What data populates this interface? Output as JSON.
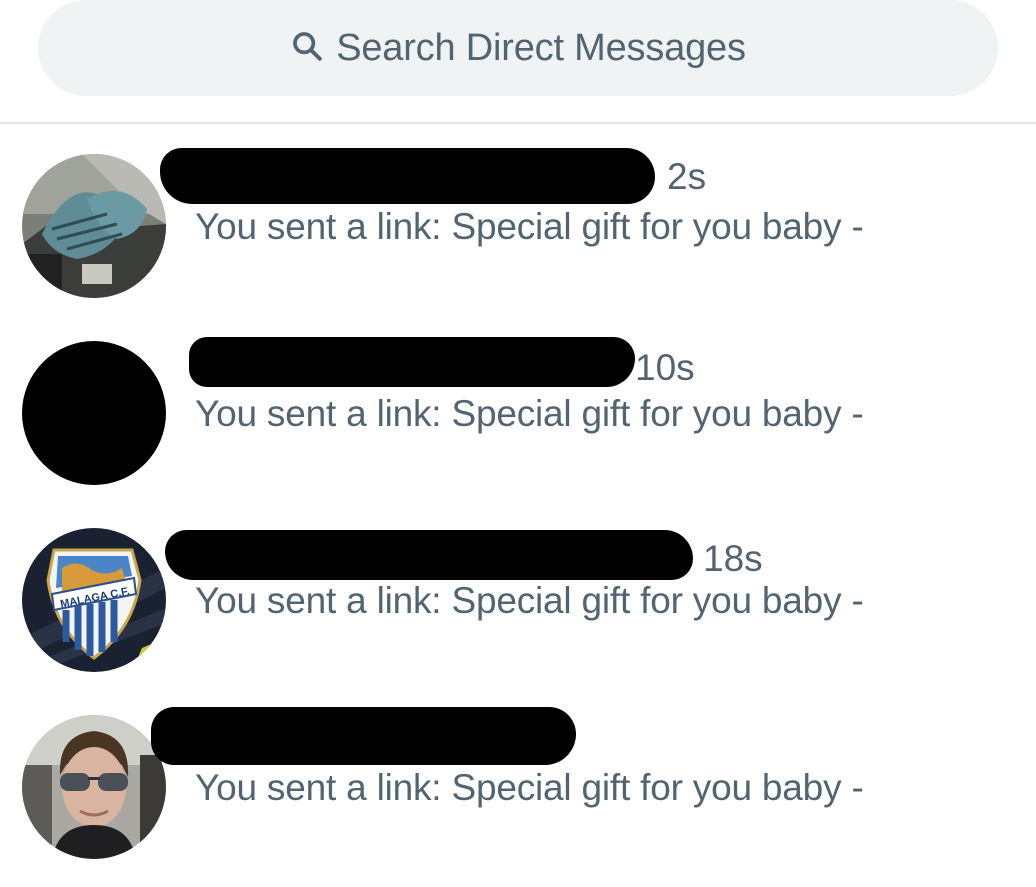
{
  "search": {
    "placeholder": "Search Direct Messages",
    "icon": "search-icon"
  },
  "conversations": [
    {
      "name_redacted": true,
      "time": "2s",
      "preview": "You sent a link: Special gift for you baby -"
    },
    {
      "name_redacted": true,
      "time": "10s",
      "preview": "You sent a link: Special gift for you baby -"
    },
    {
      "name_redacted": true,
      "time": "18s",
      "preview": "You sent a link: Special gift for you baby -"
    },
    {
      "name_redacted": true,
      "time": "",
      "preview": "You sent a link: Special gift for you baby -"
    }
  ],
  "avatar_texts": {
    "malaga_crest": "MALAGA C.F."
  },
  "colors": {
    "secondary_text": "#536471",
    "search_background": "#eff3f4",
    "divider": "#e1e6ea",
    "redaction": "#000000"
  }
}
